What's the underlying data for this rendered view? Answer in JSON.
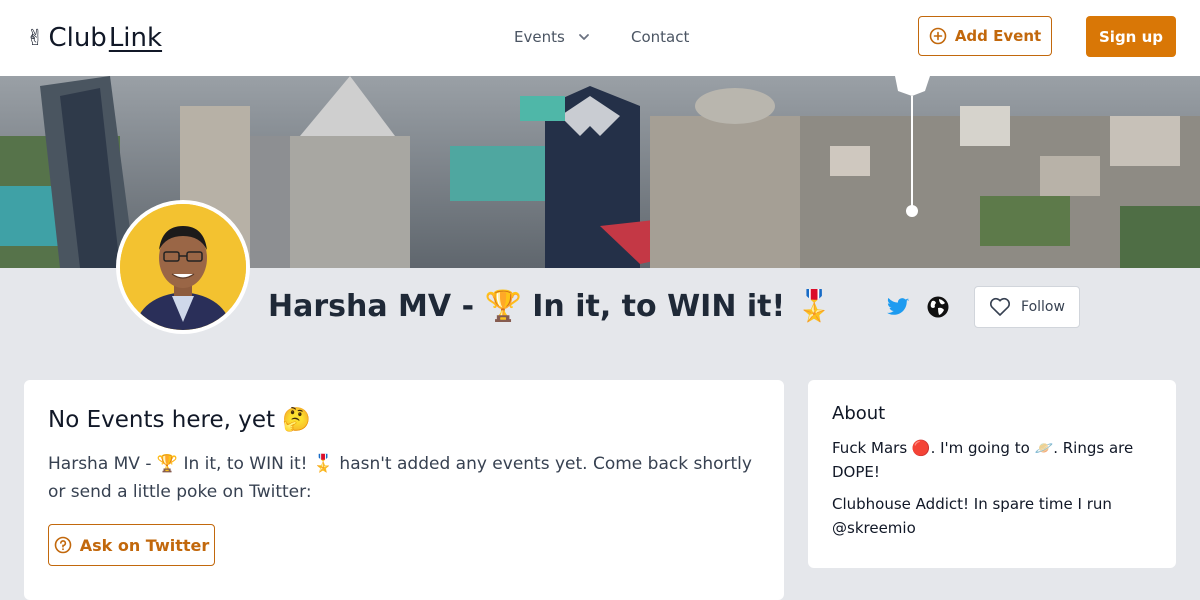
{
  "header": {
    "logo": {
      "emoji": "✌",
      "text_club": "Club",
      "text_link": "Link"
    },
    "nav": {
      "events_label": "Events",
      "contact_label": "Contact"
    },
    "add_event_label": "Add Event",
    "signup_label": "Sign up"
  },
  "profile": {
    "name": "Harsha MV - 🏆 In it, to WIN it! 🎖️",
    "follow_label": "Follow"
  },
  "events_card": {
    "title": "No Events here, yet 🤔",
    "message": "Harsha MV - 🏆 In it, to WIN it! 🎖️ hasn't added any events yet. Come back shortly or send a little poke on Twitter:",
    "ask_label": "Ask on Twitter"
  },
  "about_card": {
    "title": "About",
    "line1": "Fuck Mars 🔴. I'm going to 🪐. Rings are DOPE!",
    "line2": "Clubhouse Addict! In spare time I run @skreemio"
  },
  "colors": {
    "accent": "#d97706",
    "accent_text": "#c2680c",
    "twitter": "#1d9bf0",
    "background": "#e5e7eb"
  },
  "icons": {
    "add": "plus-circle-icon",
    "chevron": "chevron-down-icon",
    "twitter": "twitter-icon",
    "web": "globe-icon",
    "follow": "heart-icon",
    "ask": "question-circle-icon"
  }
}
